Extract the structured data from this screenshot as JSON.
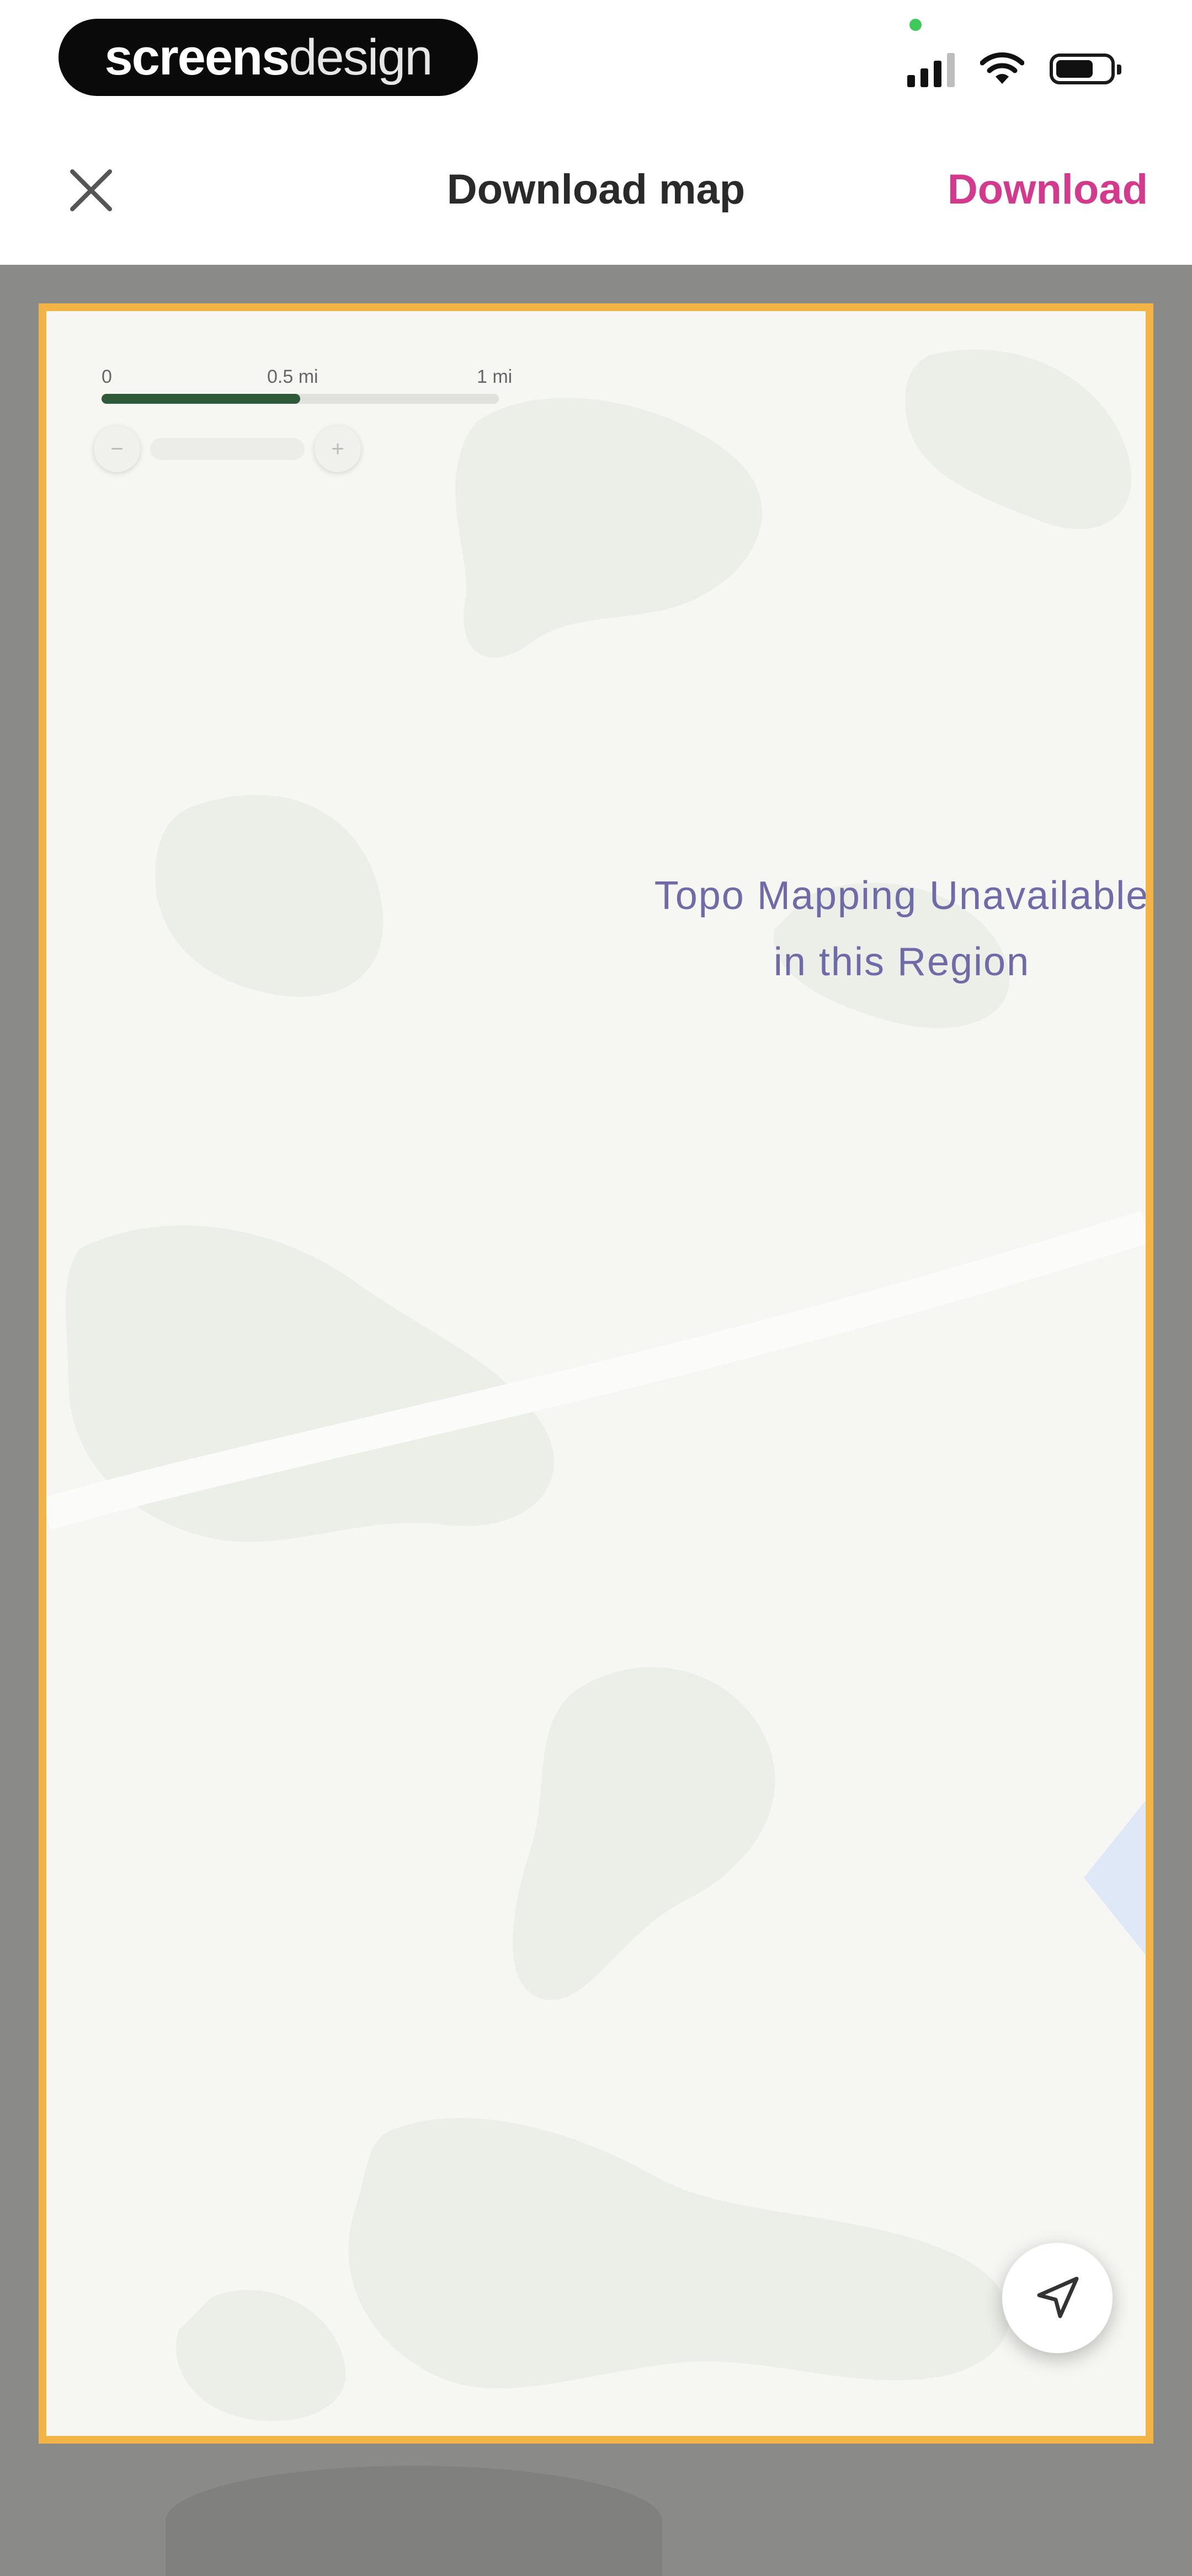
{
  "status_bar": {
    "brand_bold": "screens",
    "brand_light": "design",
    "icons": [
      "signal-icon",
      "wifi-icon",
      "battery-icon"
    ]
  },
  "nav": {
    "close_icon": "close-icon",
    "title": "Download map",
    "download_label": "Download"
  },
  "map": {
    "scale": {
      "labels": [
        "0",
        "0.5 mi",
        "1 mi"
      ],
      "fill_fraction": 0.5
    },
    "message_line1": "Topo Mapping Unavailable",
    "message_line2": "in this Region",
    "location_icon": "location-arrow-icon"
  },
  "colors": {
    "accent": "#d33a8e",
    "frame_border": "#f2b445",
    "message": "#6f6aa8",
    "scale_fill": "#2e5a3a"
  }
}
